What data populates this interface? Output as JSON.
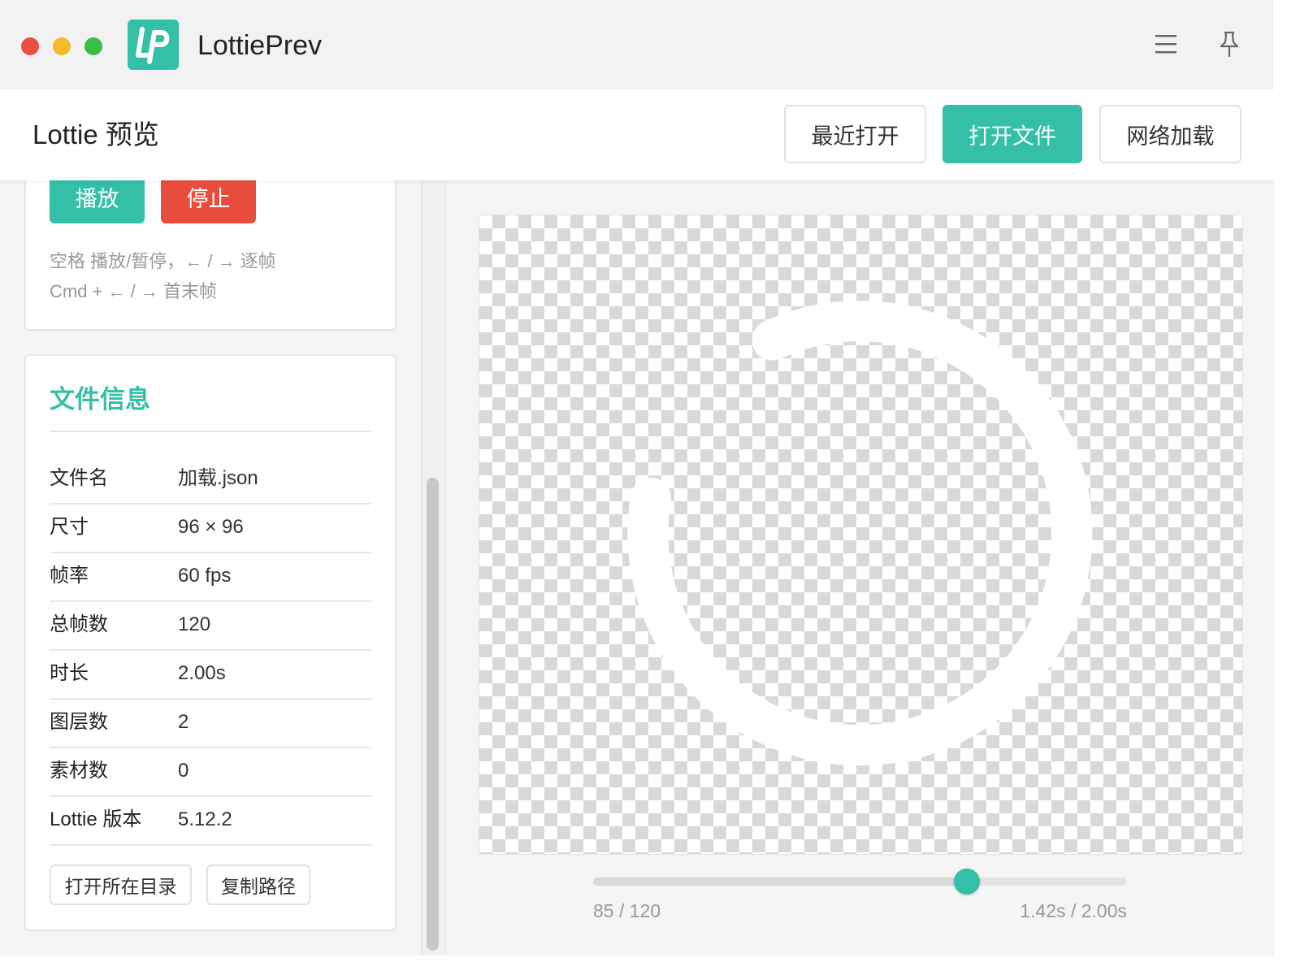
{
  "window": {
    "app_title": "LottiePrev",
    "logo_text": "lp",
    "accent_color": "#34c0a6",
    "danger_color": "#e84c3d"
  },
  "header": {
    "title": "Lottie 预览",
    "buttons": {
      "recent": "最近打开",
      "open_file": "打开文件",
      "network_load": "网络加载"
    }
  },
  "controls": {
    "play": "播放",
    "stop": "停止",
    "hint_line1": "空格 播放/暂停，← / → 逐帧",
    "hint_line2": "Cmd + ← / → 首末帧"
  },
  "file_info": {
    "title": "文件信息",
    "rows": [
      {
        "key": "文件名",
        "value": "加载.json"
      },
      {
        "key": "尺寸",
        "value": "96 × 96"
      },
      {
        "key": "帧率",
        "value": "60 fps"
      },
      {
        "key": "总帧数",
        "value": "120"
      },
      {
        "key": "时长",
        "value": "2.00s"
      },
      {
        "key": "图层数",
        "value": "2"
      },
      {
        "key": "素材数",
        "value": "0"
      },
      {
        "key": "Lottie 版本",
        "value": "5.12.2"
      }
    ],
    "actions": {
      "open_dir": "打开所在目录",
      "copy_path": "复制路径"
    }
  },
  "playback": {
    "current_frame": 85,
    "total_frames": 120,
    "frame_text": "85 / 120",
    "time_text": "1.42s / 2.00s",
    "progress": 0.7
  },
  "icons": {
    "menu": "menu-icon",
    "pin": "pin-icon"
  }
}
